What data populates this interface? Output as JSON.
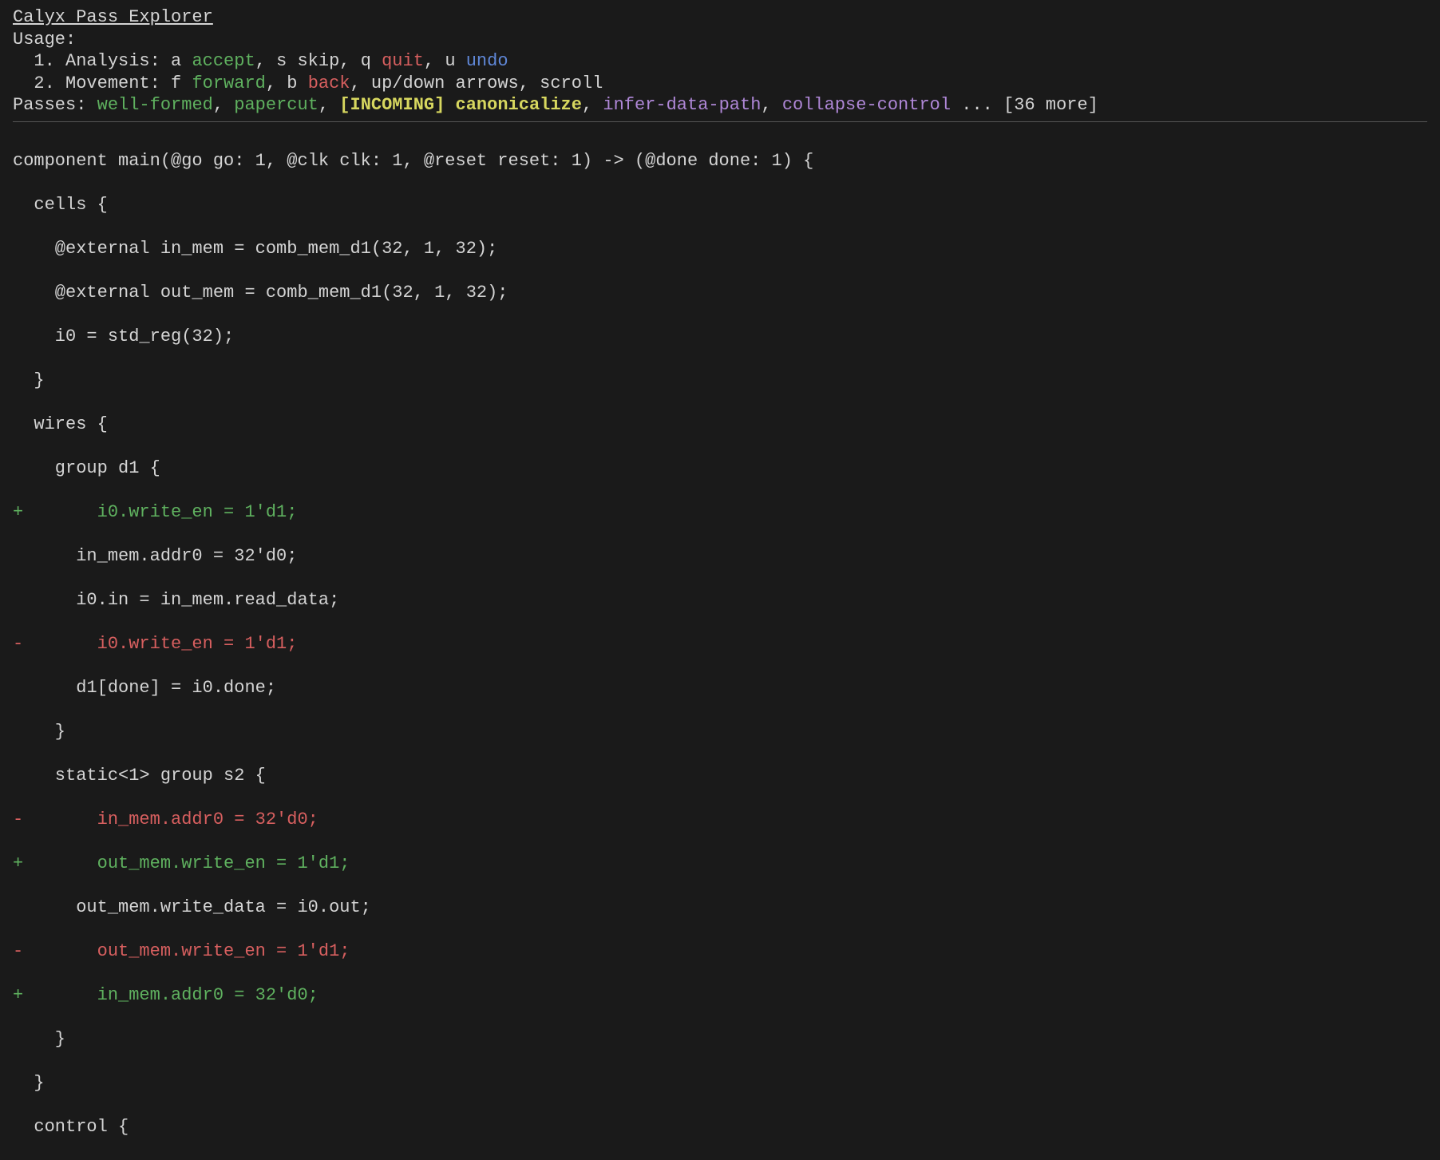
{
  "title": "Calyx Pass Explorer",
  "usage_label": "Usage:",
  "analysis": {
    "prefix": "  1. Analysis: ",
    "a_key": "a",
    "a_cmd": "accept",
    "s_key": "s",
    "s_cmd": "skip",
    "q_key": "q",
    "q_cmd": "quit",
    "u_key": "u",
    "u_cmd": "undo"
  },
  "movement": {
    "prefix": "  2. Movement: ",
    "f_key": "f",
    "f_cmd": "forward",
    "b_key": "b",
    "b_cmd": "back",
    "rest": ", up/down arrows, scroll"
  },
  "passes": {
    "label": "Passes: ",
    "p1": "well-formed",
    "p2": "papercut",
    "incoming_tag": "[INCOMING]",
    "incoming_name": "canonicalize",
    "p4": "infer-data-path",
    "p5": "collapse-control",
    "ellipsis": " ... ",
    "more": "[36 more]"
  },
  "code": {
    "l01": "component main(@go go: 1, @clk clk: 1, @reset reset: 1) -> (@done done: 1) {",
    "l02": "  cells {",
    "l03": "    @external in_mem = comb_mem_d1(32, 1, 32);",
    "l04": "    @external out_mem = comb_mem_d1(32, 1, 32);",
    "l05": "    i0 = std_reg(32);",
    "l06": "  }",
    "l07": "  wires {",
    "l08": "    group d1 {",
    "l09": "+       i0.write_en = 1'd1;",
    "l10": "      in_mem.addr0 = 32'd0;",
    "l11": "      i0.in = in_mem.read_data;",
    "l12": "-       i0.write_en = 1'd1;",
    "l13": "      d1[done] = i0.done;",
    "l14": "    }",
    "l15": "    static<1> group s2 {",
    "l16": "-       in_mem.addr0 = 32'd0;",
    "l17": "+       out_mem.write_en = 1'd1;",
    "l18": "      out_mem.write_data = i0.out;",
    "l19": "-       out_mem.write_en = 1'd1;",
    "l20": "+       in_mem.addr0 = 32'd0;",
    "l21": "    }",
    "l22": "  }",
    "l23": "  control {"
  }
}
